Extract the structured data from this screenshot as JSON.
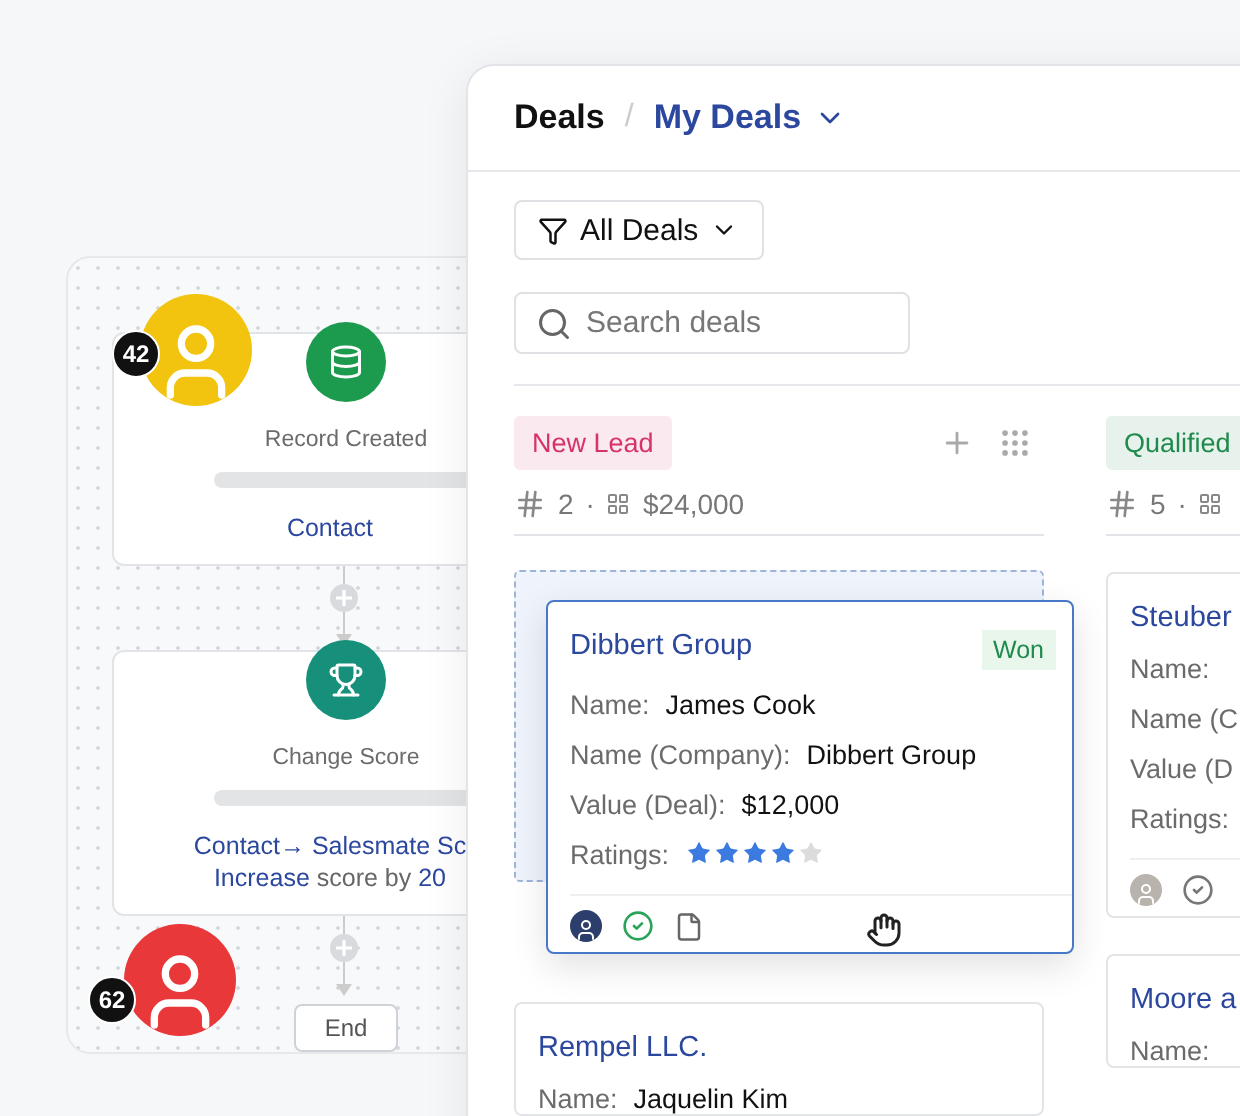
{
  "workflow": {
    "avatars": [
      {
        "badge": "42",
        "color": "#f2c40f"
      },
      {
        "badge": "62",
        "color": "#e8383a"
      }
    ],
    "nodes": [
      {
        "kind": "trigger",
        "title": "Record Created",
        "lines": [
          [
            {
              "text": "Contact",
              "highlight": true
            }
          ]
        ]
      },
      {
        "kind": "action",
        "title": "Change Score",
        "lines": [
          [
            {
              "text": "Contact→ Salesmate Sc",
              "highlight": true
            }
          ],
          [
            {
              "text": "Increase",
              "highlight": true
            },
            {
              "text": "score by",
              "highlight": false
            },
            {
              "text": "20",
              "highlight": true
            }
          ]
        ]
      }
    ],
    "end_label": "End"
  },
  "deals": {
    "breadcrumb": "Deals",
    "separator": "/",
    "view": "My Deals",
    "filter": "All Deals",
    "search": {
      "placeholder": "Search deals"
    },
    "columns": [
      {
        "name": "New Lead",
        "color": "#d6336c",
        "count": "2",
        "dot": "·",
        "amount": "$24,000",
        "actions": true,
        "cards": [
          {
            "company": "Dibbert Group",
            "badge": "Won",
            "dragging": true,
            "fields": [
              {
                "label": "Name:",
                "value": "James Cook"
              },
              {
                "label": "Name (Company):",
                "value": "Dibbert Group"
              },
              {
                "label": "Value (Deal):",
                "value": "$12,000"
              }
            ],
            "ratings_label": "Ratings:",
            "stars": 4,
            "footer": {
              "task_done": true,
              "has_file": true
            }
          },
          {
            "company": "Rempel LLC.",
            "dragging": false,
            "fields": [
              {
                "label": "Name:",
                "value": "Jaquelin Kim"
              }
            ]
          }
        ]
      },
      {
        "name": "Qualified",
        "color": "#1f8a4c",
        "count": "5",
        "dot": "·",
        "cards": [
          {
            "company": "Steuber",
            "dragging": false,
            "fields": [
              {
                "label": "Name:"
              },
              {
                "label": "Name (C"
              },
              {
                "label": "Value (D"
              }
            ],
            "ratings_label": "Ratings:",
            "footer": {
              "task_done": false,
              "has_file": false
            }
          },
          {
            "company": "Moore a",
            "dragging": false,
            "fields": [
              {
                "label": "Name:"
              }
            ]
          }
        ]
      }
    ]
  }
}
